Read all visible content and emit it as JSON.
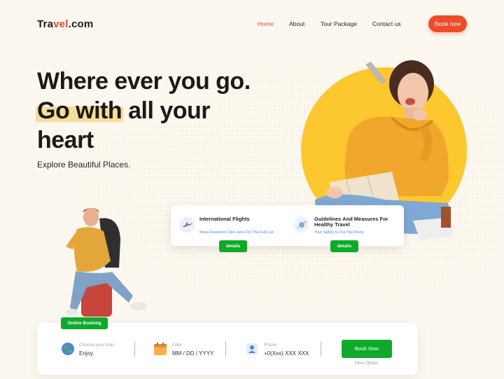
{
  "header": {
    "logo_prefix": "Tra",
    "logo_accent": "vel",
    "logo_suffix": ".com",
    "nav": [
      "Home",
      "About",
      "Tour Package",
      "Contact us"
    ],
    "book_label": "Book now"
  },
  "hero": {
    "line1": "Where ever you go.",
    "line2_highlight": "Go with",
    "line2_rest": " all your",
    "line3": "heart",
    "subtitle": "Explore Beautiful Places."
  },
  "info_card": {
    "items": [
      {
        "title": "International Flights",
        "desc": "Move Restored Click Here For The Full List",
        "button": "details"
      },
      {
        "title": "Guidelines And Measures For Healthy Travel",
        "desc": "Your Safety Is Our Top Piroty",
        "button": "details"
      }
    ]
  },
  "booking": {
    "tab_label": "Online Booking",
    "place_label": "Choose your plas",
    "place_value": "Enjoy",
    "date_label": "Date",
    "date_value": "MM / DD / YYYY",
    "phone_label": "Phone",
    "phone_value": "+0(Xxx) XXX XXX",
    "book_label": "Book Now",
    "more_label": "More Option"
  },
  "colors": {
    "background": "#fdf8ef",
    "accent_red": "#ee4b2b",
    "accent_yellow": "#fdc72f",
    "highlight": "#f8dd9a",
    "green": "#0eaa2a"
  },
  "icons": [
    "plane-icon",
    "virus-icon",
    "globe-icon",
    "calendar-icon",
    "phone-contact-icon"
  ]
}
